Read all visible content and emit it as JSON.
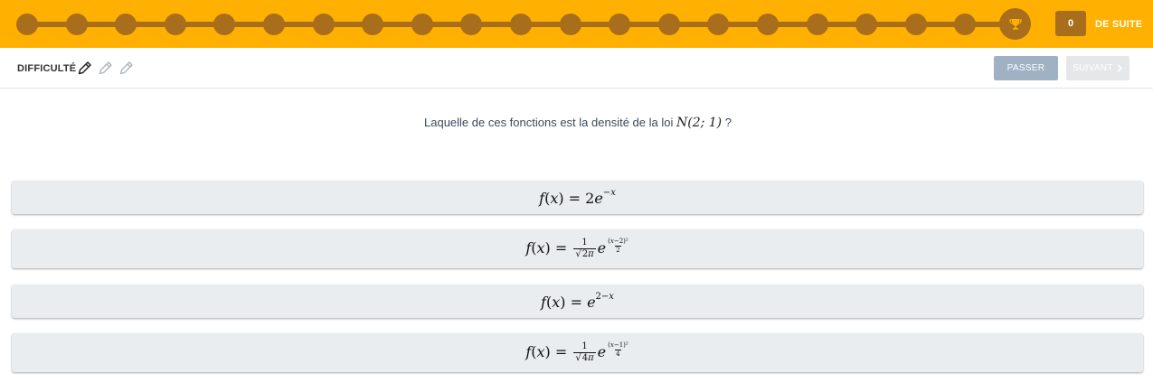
{
  "progress": {
    "steps_total": 20,
    "steps_completed": 0,
    "track_color": "#a86e1c",
    "bar_color": "#ffb000",
    "trophy_icon": "trophy-icon"
  },
  "streak": {
    "count": "0",
    "label": "DE SUITE"
  },
  "toolbar": {
    "difficulty_label": "DIFFICULTÉ",
    "difficulty_level": 1,
    "difficulty_max": 3,
    "skip_label": "PASSER",
    "next_label": "SUIVANT"
  },
  "question": {
    "text": "Laquelle de ces fonctions est la densité de la loi",
    "math": "N(2; 1)",
    "suffix": " ?"
  },
  "answers": [
    {
      "latex": "f(x) = 2e^{-x}"
    },
    {
      "latex": "f(x) = \\frac{1}{\\sqrt{2\\pi}} e^{\\frac{(x-2)^2}{2}}"
    },
    {
      "latex": "f(x) = e^{2-x}"
    },
    {
      "latex": "f(x) = \\frac{1}{\\sqrt{4\\pi}} e^{\\frac{(x-1)^2}{4}}"
    }
  ]
}
